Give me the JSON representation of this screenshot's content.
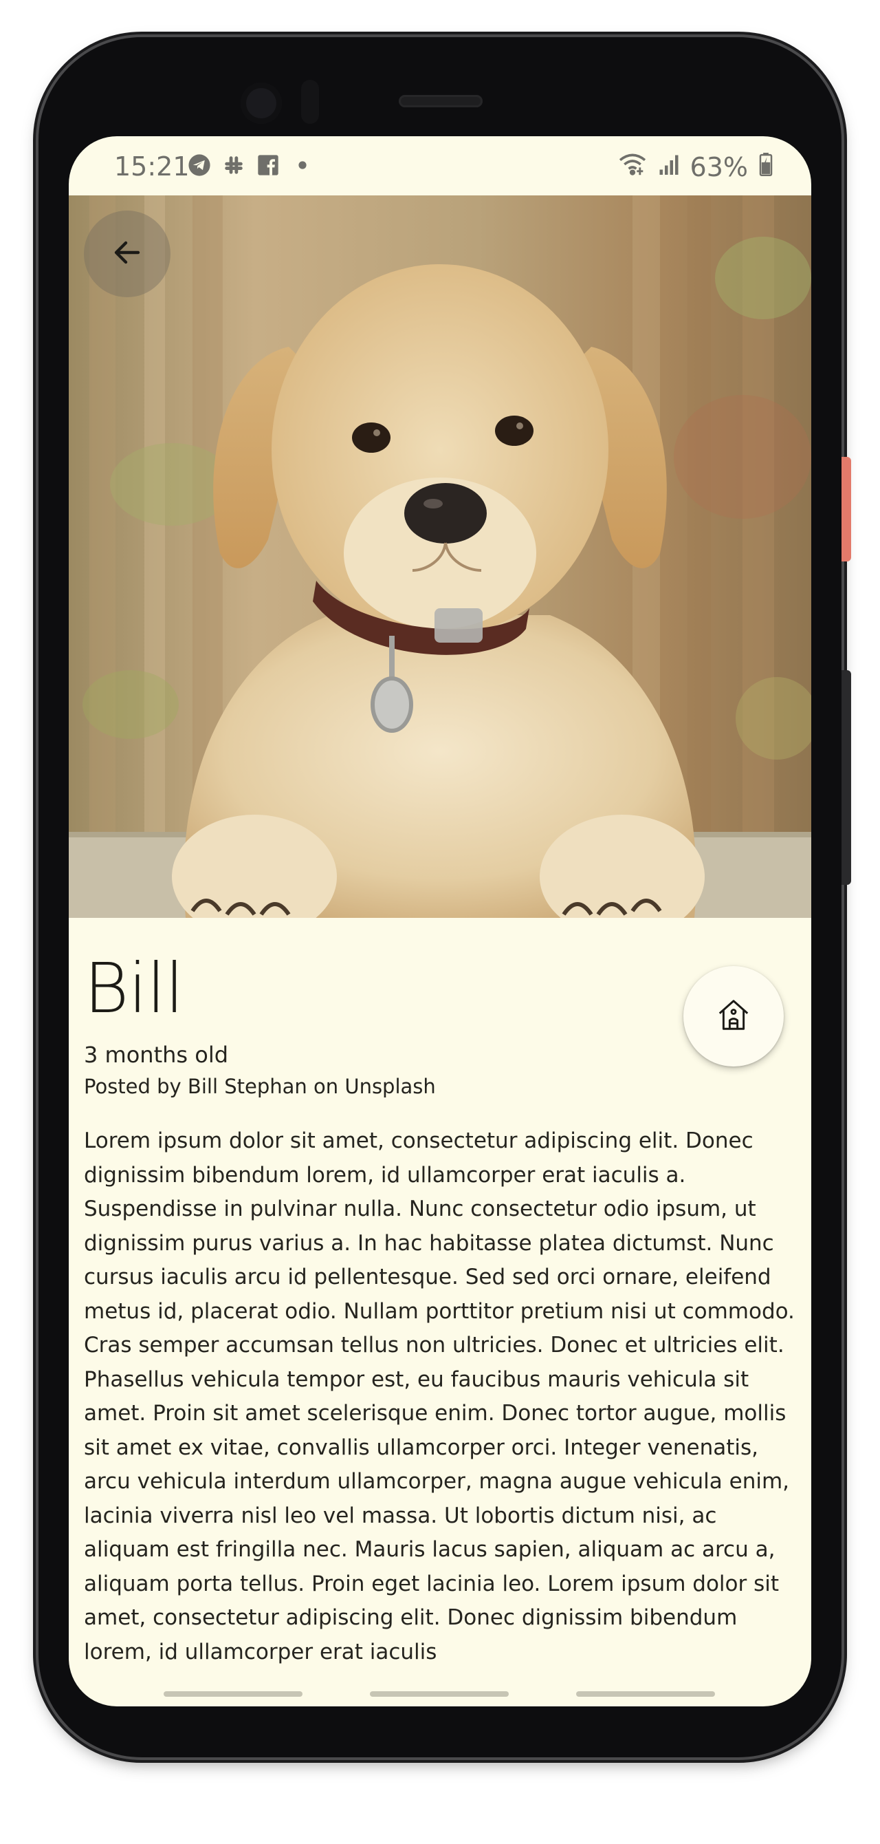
{
  "status_bar": {
    "time": "15:21",
    "left_icons": [
      "telegram-icon",
      "slack-icon",
      "facebook-icon",
      "dot-icon"
    ],
    "right_icons": [
      "wifi-icon",
      "signal-icon",
      "battery-icon"
    ],
    "battery": "63%"
  },
  "hero": {
    "image_description_icon": "puppy-photo"
  },
  "pet": {
    "name": "Bill",
    "age": "3 months old",
    "credit": "Posted by Bill Stephan on Unsplash",
    "description": "Lorem ipsum dolor sit amet, consectetur adipiscing elit. Donec dignissim bibendum lorem, id ullamcorper erat iaculis a. Suspendisse in pulvinar nulla. Nunc consectetur odio ipsum, ut dignissim purus varius a. In hac habitasse platea dictumst. Nunc cursus iaculis arcu id pellentesque. Sed sed orci ornare, eleifend metus id, placerat odio. Nullam porttitor pretium nisi ut commodo. Cras semper accumsan tellus non ultricies. Donec et ultricies elit. Phasellus vehicula tempor est, eu faucibus mauris vehicula sit amet. Proin sit amet scelerisque enim. Donec tortor augue, mollis sit amet ex vitae, convallis ullamcorper orci. Integer venenatis, arcu vehicula interdum ullamcorper, magna augue vehicula enim, lacinia viverra nisl leo vel massa. Ut lobortis dictum nisi, ac aliquam est fringilla nec. Mauris lacus sapien, aliquam ac arcu a, aliquam porta tellus. Proin eget lacinia leo. Lorem ipsum dolor sit amet, consectetur adipiscing elit. Donec dignissim bibendum lorem, id ullamcorper erat iaculis"
  },
  "colors": {
    "background": "#fdfbe8",
    "text": "#25241f",
    "fab": "#fefcf0"
  }
}
